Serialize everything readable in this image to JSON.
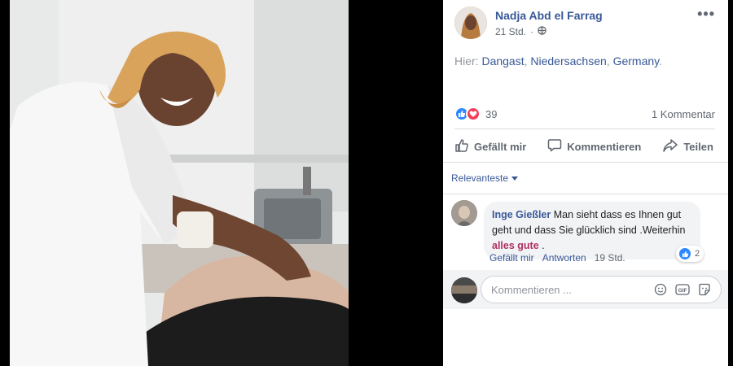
{
  "post": {
    "author": "Nadja Abd el Farrag",
    "time": "21 Std.",
    "separator": "·",
    "location_prefix": "Hier:",
    "location_parts": [
      "Dangast",
      "Niedersachsen",
      "Germany"
    ],
    "reaction_count": "39",
    "comment_count": "1 Kommentar",
    "actions": {
      "like": "Gefällt mir",
      "comment": "Kommentieren",
      "share": "Teilen"
    },
    "more_label": "•••"
  },
  "comments": {
    "sort_label": "Relevanteste",
    "items": [
      {
        "author": "Inge Gießler",
        "text": "Man sieht dass es Ihnen gut geht und dass Sie glücklich sind .Weiterhin",
        "highlight": "alles gute",
        "tail": " .",
        "reaction_count": "2",
        "like_label": "Gefällt mir",
        "reply_label": "Antworten",
        "time": "19 Std."
      }
    ]
  },
  "composer": {
    "placeholder": "Kommentieren ..."
  },
  "colors": {
    "link": "#385898",
    "like_blue": "#2d88ff",
    "love_red": "#f33e58",
    "highlight": "#b03060"
  }
}
